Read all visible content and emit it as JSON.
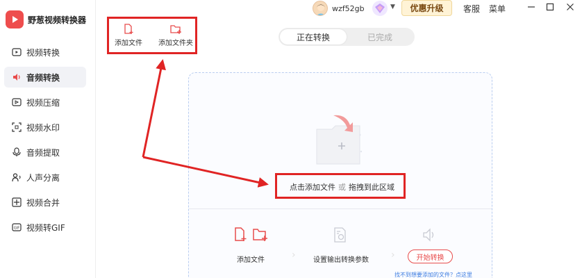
{
  "app": {
    "name": "野葱视频转换器",
    "logo_icon": "app-logo-icon"
  },
  "sidebar": {
    "items": [
      {
        "label": "视频转换",
        "icon": "video-convert-icon",
        "active": false
      },
      {
        "label": "音频转换",
        "icon": "audio-convert-icon",
        "active": true
      },
      {
        "label": "视频压缩",
        "icon": "video-compress-icon",
        "active": false
      },
      {
        "label": "视频水印",
        "icon": "watermark-icon",
        "active": false
      },
      {
        "label": "音频提取",
        "icon": "audio-extract-icon",
        "active": false
      },
      {
        "label": "人声分离",
        "icon": "vocal-separate-icon",
        "active": false
      },
      {
        "label": "视频合并",
        "icon": "video-merge-icon",
        "active": false
      },
      {
        "label": "视频转GIF",
        "icon": "video-to-gif-icon",
        "active": false
      }
    ]
  },
  "topbar": {
    "username": "wzf52gb",
    "promo_label": "优惠升级",
    "service_label": "客服",
    "menu_label": "菜单"
  },
  "toolbar": {
    "add_file_label": "添加文件",
    "add_folder_label": "添加文件夹"
  },
  "tabs": {
    "converting": "正在转换",
    "completed": "已完成"
  },
  "dropzone": {
    "hint_left": "点击添加文件",
    "hint_or": "或",
    "hint_right": "拖拽到此区域"
  },
  "steps": {
    "add_file": "添加文件",
    "set_params": "设置输出转换参数",
    "start_button": "开始转换",
    "help_link": "找不到想要添加的文件？点这里"
  },
  "colors": {
    "accent": "#e84c4c",
    "annotation": "#e02424",
    "promo_bg": "#fff3d6",
    "dashed_border": "#b9cdf0"
  }
}
